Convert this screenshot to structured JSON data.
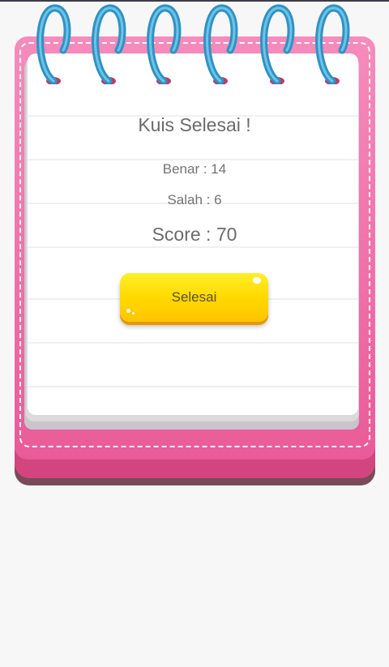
{
  "quiz": {
    "title": "Kuis Selesai !",
    "benar_text": "Benar : 14",
    "salah_text": "Salah : 6",
    "score_text": "Score : 70",
    "finish_button_label": "Selesai"
  },
  "colors": {
    "cover_pink": "#ef6fa8",
    "ring_blue": "#35a3d4",
    "button_yellow": "#ffd900",
    "text_gray": "#6b6b6b"
  }
}
